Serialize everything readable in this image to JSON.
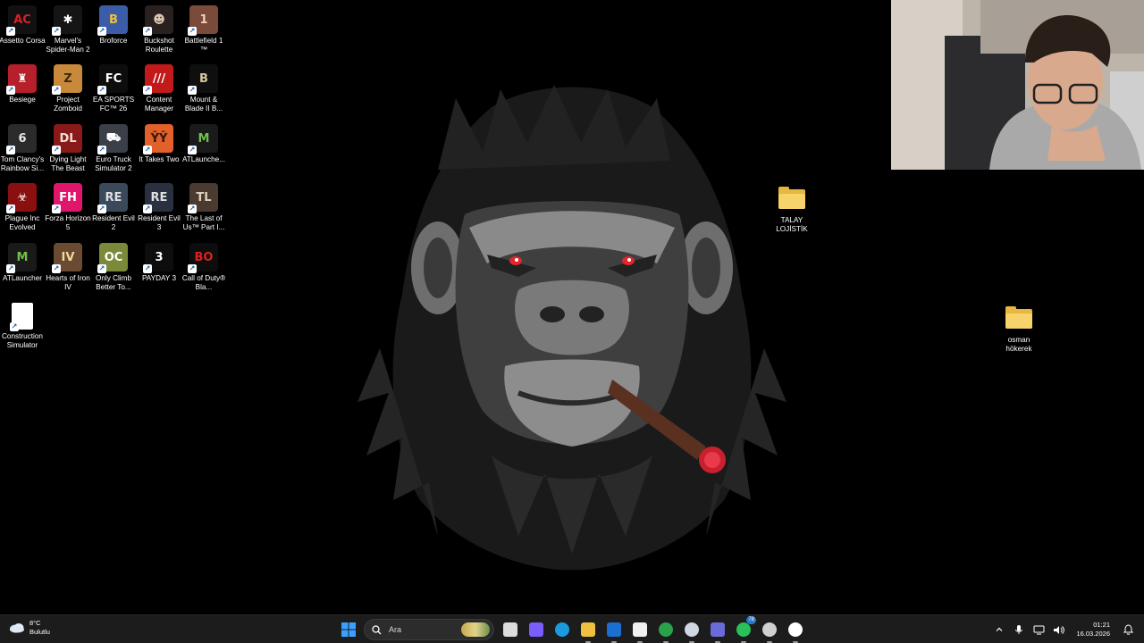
{
  "desktop": {
    "icons": [
      {
        "label": "Assetto Corsa",
        "icon": "assetto-corsa-icon",
        "bg": "#111111",
        "fg": "#d8202a",
        "glyph": "AC"
      },
      {
        "label": "Marvel's Spider-Man 2",
        "icon": "spiderman-icon",
        "bg": "#151515",
        "fg": "#ffffff",
        "glyph": "✱"
      },
      {
        "label": "Broforce",
        "icon": "broforce-icon",
        "bg": "#3b5da8",
        "fg": "#f0c040",
        "glyph": "B"
      },
      {
        "label": "Buckshot Roulette",
        "icon": "buckshot-roulette-icon",
        "bg": "#2a2020",
        "fg": "#d9c7b0",
        "glyph": "☻"
      },
      {
        "label": "Battlefield 1 ™",
        "icon": "battlefield-icon",
        "bg": "#7a4a3a",
        "fg": "#f2d3b5",
        "glyph": "1"
      },
      {
        "label": "Besiege",
        "icon": "besiege-icon",
        "bg": "#b5202a",
        "fg": "#ffffff",
        "glyph": "♜"
      },
      {
        "label": "Project Zomboid",
        "icon": "project-zomboid-icon",
        "bg": "#c88a3a",
        "fg": "#3a2a10",
        "glyph": "Z"
      },
      {
        "label": "EA SPORTS FC™ 26",
        "icon": "ea-fc-icon",
        "bg": "#0d0d0d",
        "fg": "#ffffff",
        "glyph": "FC"
      },
      {
        "label": "Content Manager",
        "icon": "content-manager-icon",
        "bg": "#c21a1a",
        "fg": "#ffffff",
        "glyph": "///"
      },
      {
        "label": "Mount & Blade II B...",
        "icon": "bannerlord-icon",
        "bg": "#0f0f0f",
        "fg": "#d8c7a0",
        "glyph": "B"
      },
      {
        "label": "Tom Clancy's Rainbow Si...",
        "icon": "rainbow-six-icon",
        "bg": "#2b2b2b",
        "fg": "#e8e8e8",
        "glyph": "6"
      },
      {
        "label": "Dying Light The Beast",
        "icon": "dying-light-icon",
        "bg": "#8a1a1a",
        "fg": "#f0e0d0",
        "glyph": "DL"
      },
      {
        "label": "Euro Truck Simulator 2",
        "icon": "euro-truck-icon",
        "bg": "#3a3f48",
        "fg": "#ffffff",
        "glyph": "⛟"
      },
      {
        "label": "It Takes Two",
        "icon": "it-takes-two-icon",
        "bg": "#e2602a",
        "fg": "#2a1a10",
        "glyph": "ŶŶ"
      },
      {
        "label": "ATLaunche...",
        "icon": "atlauncher-icon",
        "bg": "#1a1a1a",
        "fg": "#6fc04a",
        "glyph": "M"
      },
      {
        "label": "Plague Inc Evolved",
        "icon": "plague-inc-icon",
        "bg": "#8a1010",
        "fg": "#ffffff",
        "glyph": "☣"
      },
      {
        "label": "Forza Horizon 5",
        "icon": "forza-horizon-icon",
        "bg": "#e0166c",
        "fg": "#ffffff",
        "glyph": "FH"
      },
      {
        "label": "Resident Evil 2",
        "icon": "resident-evil-2-icon",
        "bg": "#3a4a5a",
        "fg": "#e0e0e0",
        "glyph": "RE"
      },
      {
        "label": "Resident Evil 3",
        "icon": "resident-evil-3-icon",
        "bg": "#2a3040",
        "fg": "#e0e0e0",
        "glyph": "RE"
      },
      {
        "label": "The Last of Us™ Part I...",
        "icon": "last-of-us-icon",
        "bg": "#4a3a30",
        "fg": "#e0d0c0",
        "glyph": "TL"
      },
      {
        "label": "ATLauncher",
        "icon": "atlauncher-icon",
        "bg": "#1a1a1a",
        "fg": "#6fc04a",
        "glyph": "M"
      },
      {
        "label": "Hearts of Iron IV",
        "icon": "hearts-of-iron-icon",
        "bg": "#6a4a30",
        "fg": "#f0d8a0",
        "glyph": "IV"
      },
      {
        "label": "Only Climb Better To...",
        "icon": "only-climb-icon",
        "bg": "#7a8a3a",
        "fg": "#ffffff",
        "glyph": "OC"
      },
      {
        "label": "PAYDAY 3",
        "icon": "payday-icon",
        "bg": "#0d0d0d",
        "fg": "#ffffff",
        "glyph": "3"
      },
      {
        "label": "Call of Duty® Bla...",
        "icon": "call-of-duty-icon",
        "bg": "#0d0d0d",
        "fg": "#e02020",
        "glyph": "BO"
      },
      {
        "label": "Construction Simulator",
        "icon": "file-icon",
        "bg": "#ffffff",
        "fg": "#cccccc",
        "glyph": ""
      }
    ],
    "folders": [
      {
        "label": "TALAY LOJİSTİK",
        "icon": "folder-icon"
      },
      {
        "label": "osman hökerek",
        "icon": "folder-icon"
      }
    ]
  },
  "taskbar": {
    "weather": {
      "temp": "8°C",
      "condition": "Bulutlu",
      "icon": "cloud-icon"
    },
    "search": {
      "placeholder": "Ara",
      "icon": "search-icon"
    },
    "apps": [
      {
        "name": "task-view",
        "icon": "task-view-icon",
        "color": "#dcdcdc"
      },
      {
        "name": "copilot",
        "icon": "copilot-icon",
        "color": "#7a5cff"
      },
      {
        "name": "edge",
        "icon": "edge-icon",
        "color": "#1a9be0"
      },
      {
        "name": "file-explorer",
        "icon": "folder-icon",
        "color": "#f0c040"
      },
      {
        "name": "outlook",
        "icon": "mail-icon",
        "color": "#1a6fd0"
      },
      {
        "name": "store",
        "icon": "store-icon",
        "color": "#f0f0f0"
      },
      {
        "name": "chrome",
        "icon": "chrome-icon",
        "color": "#2aa24a"
      },
      {
        "name": "steam",
        "icon": "steam-icon",
        "color": "#cfd8e0"
      },
      {
        "name": "teams",
        "icon": "teams-icon",
        "color": "#6a6ad8"
      },
      {
        "name": "whatsapp",
        "icon": "whatsapp-icon",
        "color": "#2ac05a",
        "badge": "78"
      },
      {
        "name": "obs",
        "icon": "obs-icon",
        "color": "#d0d0d0"
      },
      {
        "name": "steam-2",
        "icon": "steam-icon",
        "color": "#ffffff"
      }
    ],
    "tray": {
      "icons": [
        "chevron-up-icon",
        "microphone-icon",
        "network-icon",
        "volume-icon"
      ],
      "time": "01:21",
      "date": "16.03.2026",
      "notification_icon": "bell-icon"
    }
  }
}
